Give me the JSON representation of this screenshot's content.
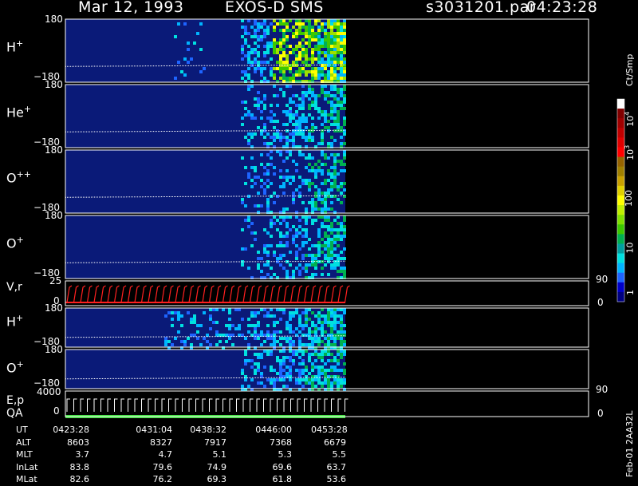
{
  "header": {
    "date": "Mar 12, 1993",
    "instrument": "EXOS-D SMS",
    "file": "s3031201.par",
    "time": "04:23:28"
  },
  "side_label": "Feb-01 2AA32L",
  "colorbar": {
    "unit_label": "Ct/Smp",
    "tick_labels": [
      "10",
      "4",
      "10",
      "3",
      "100",
      "10",
      "1"
    ]
  },
  "panels": [
    {
      "label": "H",
      "sup": "+",
      "ymax": "180",
      "ymin": "−180"
    },
    {
      "label": "He",
      "sup": "+",
      "ymax": "180",
      "ymin": "−180"
    },
    {
      "label": "O",
      "sup": "++",
      "ymax": "180",
      "ymin": "−180"
    },
    {
      "label": "O",
      "sup": "+",
      "ymax": "180",
      "ymin": "−180"
    },
    {
      "label": "V,r",
      "sup": "",
      "ymax": "25",
      "ymin": "0",
      "right_max": "90",
      "right_min": "0"
    },
    {
      "label": "H",
      "sup": "+",
      "ymax": "180",
      "ymin": "−180"
    },
    {
      "label": "O",
      "sup": "+",
      "ymax": "180",
      "ymin": "−180"
    },
    {
      "label": "E,p",
      "sublabel": "QA",
      "ymax": "4000",
      "ymin": "0",
      "right_max": "90",
      "right_min": "0"
    }
  ],
  "ephemeris": {
    "row_labels": [
      "UT",
      "ALT",
      "MLT",
      "InLat",
      "MLat"
    ],
    "columns": [
      [
        "0423:28",
        "8603",
        "3.7",
        "83.8",
        "82.6"
      ],
      [
        "0431:04",
        "8327",
        "4.7",
        "79.6",
        "76.2"
      ],
      [
        "0438:32",
        "7917",
        "5.1",
        "74.9",
        "69.3"
      ],
      [
        "0446:00",
        "7368",
        "5.3",
        "69.6",
        "61.8"
      ],
      [
        "0453:28",
        "6679",
        "5.5",
        "63.7",
        "53.6"
      ]
    ]
  },
  "chart_data": {
    "type": "heatmap",
    "title": "Mar 12, 1993   EXOS-D SMS",
    "x_ticks": [
      "0423:28",
      "0431:04",
      "0438:32",
      "0446:00",
      "0453:28"
    ],
    "y_panels": [
      "H+",
      "He+",
      "O++",
      "O+",
      "V,r",
      "H+",
      "O+",
      "E,p / QA"
    ],
    "pitch_angle_range": [
      -180,
      180
    ],
    "color_scale": {
      "type": "log",
      "range": [
        1,
        10000
      ],
      "unit": "Ct/Smp",
      "colors": [
        "#000080",
        "#0000c8",
        "#1e64ff",
        "#00b4ff",
        "#00e0e0",
        "#00b050",
        "#3cc800",
        "#a0e000",
        "#ffff00",
        "#c8a000",
        "#966400",
        "#ff0000",
        "#c00000",
        "#800000",
        "#ffffff"
      ]
    },
    "data_extent_fraction_of_time": 0.7
  }
}
